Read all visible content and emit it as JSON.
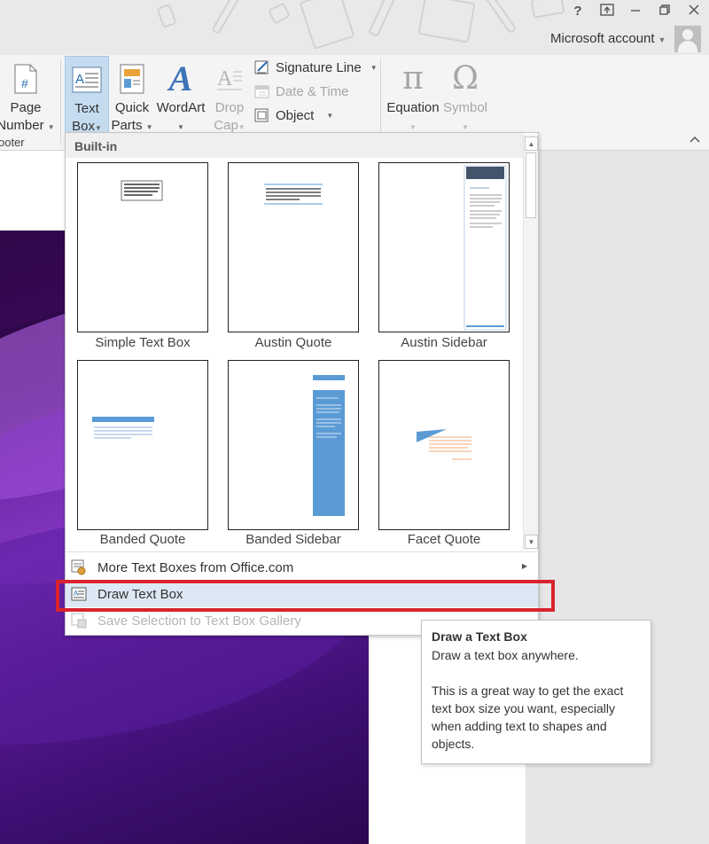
{
  "window": {
    "help": "?",
    "account_name": "Microsoft account",
    "controls": [
      "restore-ribbon",
      "minimize",
      "maximize",
      "close"
    ]
  },
  "ribbon": {
    "page_number": {
      "line1": "Page",
      "line2": "Number"
    },
    "group_footer_fragment": "ooter",
    "text_box": {
      "line1": "Text",
      "line2": "Box"
    },
    "quick_parts": {
      "line1": "Quick",
      "line2": "Parts"
    },
    "wordart": {
      "label": "WordArt"
    },
    "drop_cap": {
      "line1": "Drop",
      "line2": "Cap"
    },
    "signature_line": "Signature Line",
    "date_time": "Date & Time",
    "object": "Object",
    "equation": "Equation",
    "symbol": "Symbol"
  },
  "gallery": {
    "header": "Built-in",
    "tiles": [
      {
        "label": "Simple Text Box"
      },
      {
        "label": "Austin Quote"
      },
      {
        "label": "Austin Sidebar"
      },
      {
        "label": "Banded Quote"
      },
      {
        "label": "Banded Sidebar"
      },
      {
        "label": "Facet Quote"
      }
    ],
    "menu": [
      {
        "label": "More Text Boxes from Office.com",
        "state": "enabled"
      },
      {
        "label": "Draw Text Box",
        "state": "highlighted"
      },
      {
        "label": "Save Selection to Text Box Gallery",
        "state": "disabled"
      }
    ]
  },
  "tooltip": {
    "title": "Draw a Text Box",
    "line1": "Draw a text box anywhere.",
    "line2": "This is a great way to get the exact text box size you want, especially when adding text to shapes and objects."
  },
  "colors": {
    "accent_blue": "#5b9bd5",
    "highlight_red": "#d9232d",
    "selected_ribbon": "#c5dcf0",
    "sidebar_dark": "#44546a",
    "facet_orange": "#ed7d31"
  }
}
